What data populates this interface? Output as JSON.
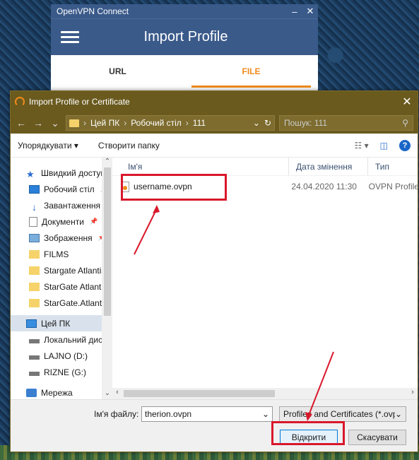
{
  "ovpn": {
    "window_title": "OpenVPN Connect",
    "minimize": "–",
    "close": "✕",
    "header_title": "Import Profile",
    "tabs": [
      {
        "label": "URL"
      },
      {
        "label": "FILE"
      }
    ]
  },
  "dialog": {
    "title": "Import Profile or Certificate",
    "close": "✕",
    "nav": {
      "back": "←",
      "forward": "→",
      "dropdown": "⌄",
      "refresh": "↻"
    },
    "path": [
      "Цей ПК",
      "Робочий стіл",
      "111"
    ],
    "search_placeholder": "Пошук: 111",
    "toolbar": {
      "organize": "Упорядкувати ▾",
      "new_folder": "Створити папку"
    },
    "sidebar": [
      {
        "label": "Швидкий доступ"
      },
      {
        "label": "Робочий стіл"
      },
      {
        "label": "Завантаження"
      },
      {
        "label": "Документи"
      },
      {
        "label": "Зображення"
      },
      {
        "label": "FILMS"
      },
      {
        "label": "Stargate Atlantis"
      },
      {
        "label": "StarGate Atlantis"
      },
      {
        "label": "StarGate.Atlantis"
      },
      {
        "label": "Цей ПК"
      },
      {
        "label": "Локальний диск"
      },
      {
        "label": "LAJNO (D:)"
      },
      {
        "label": "RIZNE (G:)"
      },
      {
        "label": "Мережа"
      }
    ],
    "columns": {
      "name": "Ім'я",
      "date": "Дата змінення",
      "type": "Тип"
    },
    "files": [
      {
        "name": "username.ovpn",
        "date": "24.04.2020 11:30",
        "type": "OVPN Profile"
      }
    ],
    "filename_label": "Ім'я файлу:",
    "filename_value": "therion.ovpn",
    "filetype_value": "Profiles and Certificates (*.ovpn",
    "open_button": "Відкрити",
    "cancel_button": "Скасувати"
  },
  "colors": {
    "accent_orange": "#f08a1c",
    "highlight_red": "#d9182b",
    "ovpn_blue": "#3a5a8a"
  }
}
